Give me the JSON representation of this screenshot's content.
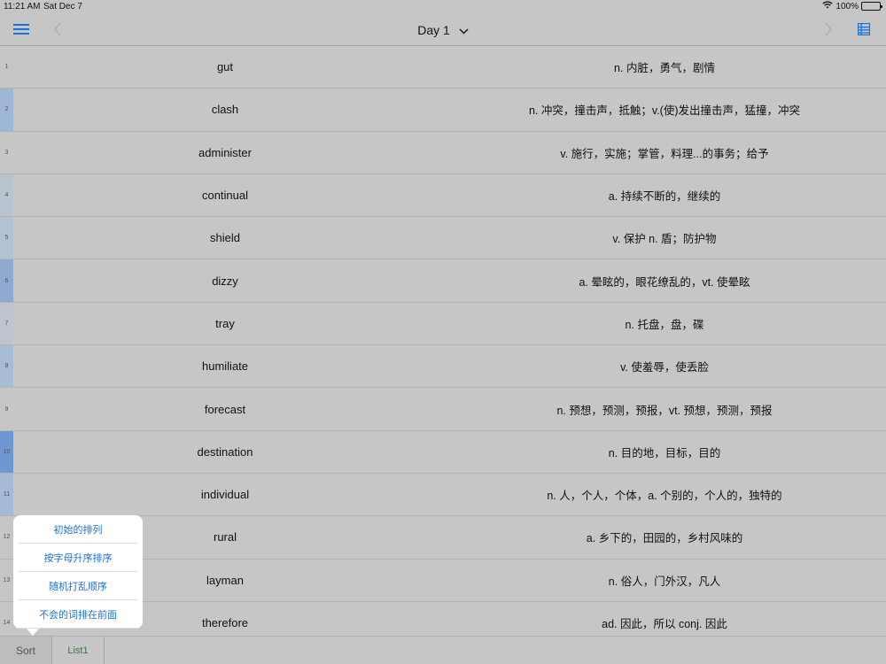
{
  "status": {
    "time": "11:21 AM",
    "date": "Sat Dec 7",
    "battery": "100%",
    "battery_level": 1.0
  },
  "nav": {
    "title": "Day 1"
  },
  "rows": [
    {
      "index": "1",
      "word": "gut",
      "meaning": "n. 内脏，勇气，剧情",
      "mark_color": ""
    },
    {
      "index": "2",
      "word": "clash",
      "meaning": "n. 冲突，撞击声，抵触；v.(使)发出撞击声，猛撞，冲突",
      "mark_color": "#9fb7d6"
    },
    {
      "index": "3",
      "word": "administer",
      "meaning": "v. 施行，实施；掌管，料理...的事务；给予",
      "mark_color": ""
    },
    {
      "index": "4",
      "word": "continual",
      "meaning": "a. 持续不断的，继续的",
      "mark_color": "#b9c3cf"
    },
    {
      "index": "5",
      "word": "shield",
      "meaning": "v. 保护 n. 盾；防护物",
      "mark_color": "#b3c2d3"
    },
    {
      "index": "6",
      "word": "dizzy",
      "meaning": "a. 晕眩的，眼花缭乱的，vt. 使晕眩",
      "mark_color": "#8eaad1"
    },
    {
      "index": "7",
      "word": "tray",
      "meaning": "n. 托盘，盘，碟",
      "mark_color": "#bdc4cd"
    },
    {
      "index": "8",
      "word": "humiliate",
      "meaning": "v. 使羞辱，使丢脸",
      "mark_color": "#a8bcd6"
    },
    {
      "index": "9",
      "word": "forecast",
      "meaning": "n. 预想，预测，预报，vt. 预想，预测，预报",
      "mark_color": ""
    },
    {
      "index": "10",
      "word": "destination",
      "meaning": "n. 目的地，目标，目的",
      "mark_color": "#6f98d2"
    },
    {
      "index": "11",
      "word": "individual",
      "meaning": "n. 人，个人，个体，a. 个别的，个人的，独特的",
      "mark_color": "#a4bad6"
    },
    {
      "index": "12",
      "word": "rural",
      "meaning": "a. 乡下的，田园的，乡村风味的",
      "mark_color": ""
    },
    {
      "index": "13",
      "word": "layman",
      "meaning": "n. 俗人，门外汉，凡人",
      "mark_color": ""
    },
    {
      "index": "14",
      "word": "therefore",
      "meaning": "ad. 因此，所以 conj. 因此",
      "mark_color": ""
    }
  ],
  "sort_menu": {
    "options": [
      "初始的排列",
      "按字母升序排序",
      "随机打乱顺序",
      "不会的词排在前面"
    ]
  },
  "tabs": {
    "sort": "Sort",
    "list1": "List1"
  },
  "colors": {
    "accent": "#1a73d8",
    "background": "#c6c6c6",
    "list_tab": "#2f7d3a"
  },
  "icons": {
    "menu": "hamburger-menu-icon",
    "back": "chevron-left-icon",
    "forward": "chevron-right-icon",
    "title_dropdown": "chevron-down-icon",
    "list": "list-icon",
    "wifi": "wifi-icon",
    "battery": "battery-icon"
  }
}
